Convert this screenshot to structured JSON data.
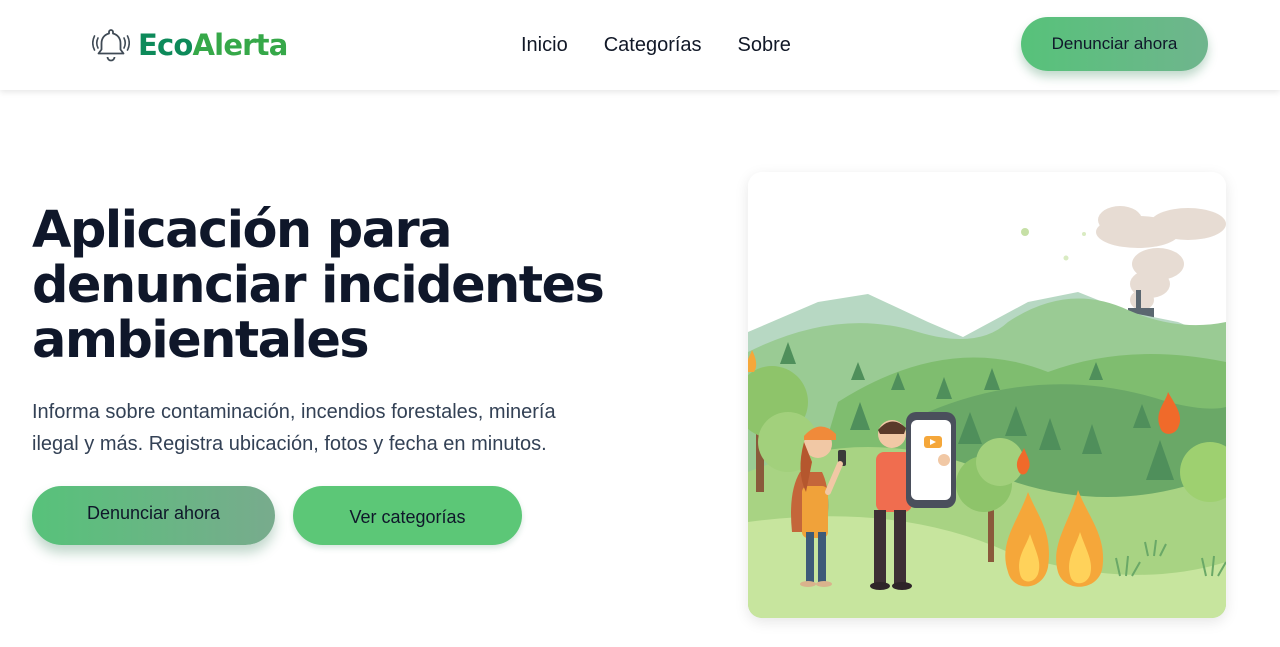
{
  "brand": {
    "name_part1": "Eco",
    "name_part2": "Alerta",
    "icon": "bell-alert-icon"
  },
  "nav": {
    "items": [
      {
        "label": "Inicio"
      },
      {
        "label": "Categorías"
      },
      {
        "label": "Sobre"
      }
    ],
    "cta_label": "Denunciar ahora"
  },
  "hero": {
    "title": "Aplicación para denunciar incidentes ambientales",
    "subtitle": "Informa sobre contaminación, incendios forestales, minería ilegal y más. Registra ubicación, fotos y fecha en minutos.",
    "primary_button": "Denunciar ahora",
    "secondary_button": "Ver categorías"
  },
  "illustration": {
    "icon": "environment-report-illustration"
  },
  "colors": {
    "brand_dark": "#0d8a5a",
    "brand_light": "#36a849",
    "button_green": "#57c27a",
    "text_dark": "#0f172a",
    "text_muted": "#334155"
  }
}
